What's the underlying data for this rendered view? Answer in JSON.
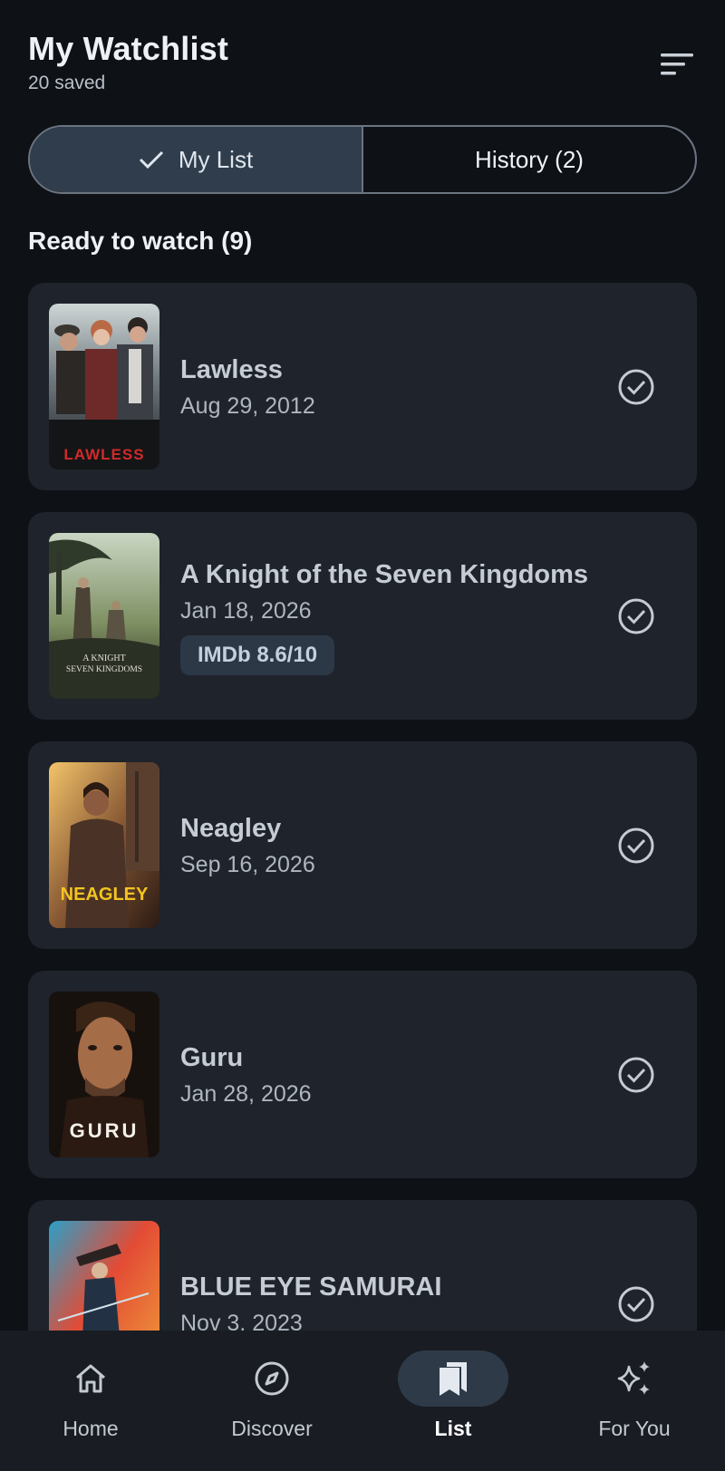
{
  "header": {
    "title": "My Watchlist",
    "subtitle": "20 saved",
    "sort_icon": "sort-icon"
  },
  "tabs": [
    {
      "label": "My List",
      "active": true
    },
    {
      "label": "History (2)",
      "active": false
    }
  ],
  "section": {
    "title": "Ready to watch (9)"
  },
  "items": [
    {
      "title": "Lawless",
      "date": "Aug 29, 2012",
      "poster_text": "LAWLESS"
    },
    {
      "title": "A Knight of the Seven Kingdoms",
      "date": "Jan 18, 2026",
      "badge": "IMDb 8.6/10",
      "poster_text_1": "A KNIGHT",
      "poster_text_2": "SEVEN KINGDOMS"
    },
    {
      "title": "Neagley",
      "date": "Sep 16, 2026",
      "poster_text": "NEAGLEY"
    },
    {
      "title": "Guru",
      "date": "Jan 28, 2026",
      "poster_text": "GURU"
    },
    {
      "title": "BLUE EYE SAMURAI",
      "date": "Nov 3, 2023"
    }
  ],
  "nav": [
    {
      "label": "Home",
      "icon": "home-icon",
      "active": false
    },
    {
      "label": "Discover",
      "icon": "compass-icon",
      "active": false
    },
    {
      "label": "List",
      "icon": "bookmarks-icon",
      "active": true
    },
    {
      "label": "For You",
      "icon": "sparkles-icon",
      "active": false
    }
  ],
  "colors": {
    "background": "#0e1116",
    "card": "#1f232b",
    "active_tab": "#303d4c",
    "nav_bar": "#191c22"
  }
}
